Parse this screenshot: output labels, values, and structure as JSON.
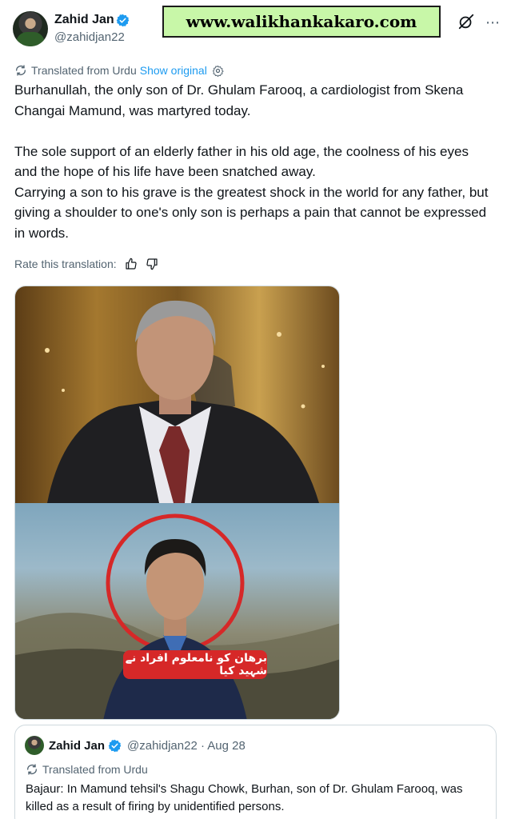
{
  "author": {
    "name": "Zahid Jan",
    "handle": "@zahidjan22"
  },
  "watermark": {
    "text": "www.walikhankakaro.com",
    "background": "#c8f7a8"
  },
  "icons": {
    "grok": "grok-icon",
    "more": "more-icon",
    "verified": "verified-badge-icon",
    "translate": "translate-icon",
    "settings": "gear-icon",
    "thumbs_up": "thumbs-up-icon",
    "thumbs_down": "thumbs-down-icon"
  },
  "translation": {
    "label": "Translated from Urdu",
    "show_original": "Show original"
  },
  "tweet": {
    "text": "Burhanullah, the only son of Dr. Ghulam Farooq, a cardiologist from Skena Changai Mamund, was martyred today.\n\nThe sole support of an elderly father in his old age, the coolness of his eyes and the hope of his life have been snatched away.\nCarrying a son to his grave is the greatest shock in the world for any father, but giving a shoulder to one's only son is perhaps a pain that cannot be expressed in words."
  },
  "rate": {
    "label": "Rate this translation:"
  },
  "media": {
    "caption_urdu": "برھان کو نامعلوم افراد نے شہید کیا",
    "caption_color": "#d62828"
  },
  "quote": {
    "name": "Zahid Jan",
    "meta": "@zahidjan22 · Aug 28",
    "translated": "Translated from Urdu",
    "text": "Bajaur: In Mamund tehsil's Shagu Chowk, Burhan, son of Dr. Ghulam Farooq, was killed as a result of firing by unidentified persons."
  },
  "colors": {
    "accent": "#1d9bf0",
    "secondary_text": "#536471",
    "primary_text": "#0f1419"
  }
}
